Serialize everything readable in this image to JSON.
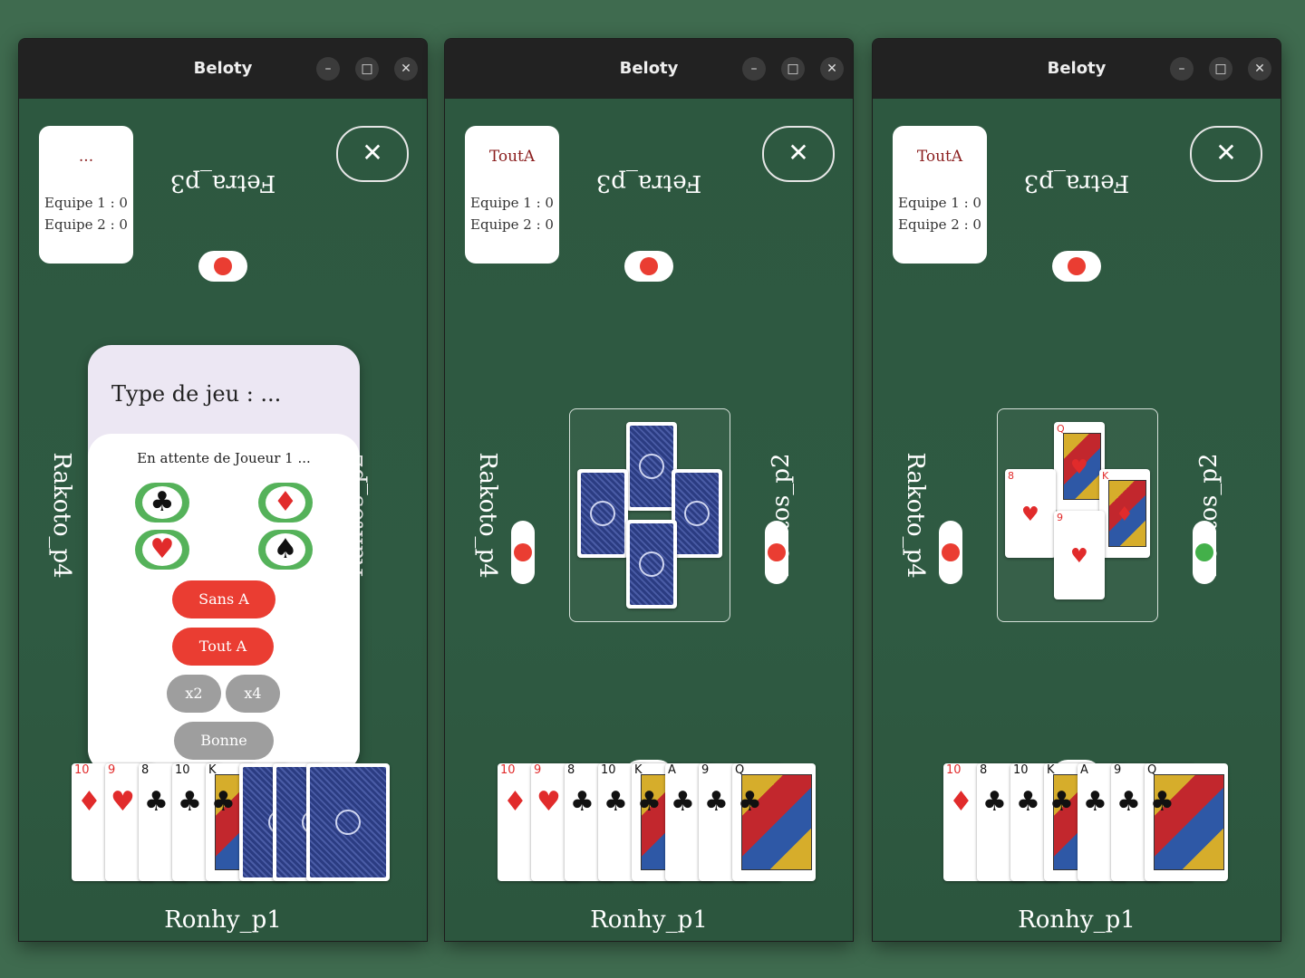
{
  "windows": [
    {
      "title": "Beloty",
      "score": {
        "mode": "...",
        "team1": "Equipe 1 : 0",
        "team2": "Equipe 2 : 0"
      },
      "close_label": "✕",
      "players": {
        "top": "Fetra_p3",
        "left": "Rakoto_p4",
        "right": "Raktos_p2",
        "bottom": "Ronhy_p1"
      },
      "dialog": {
        "title": "Type de jeu : ...",
        "waiting": "En attente de Joueur 1 ...",
        "suits": [
          "♣",
          "♦",
          "♥",
          "♠"
        ],
        "buttons": {
          "sans_a": "Sans A",
          "tout_a": "Tout A",
          "x2": "x2",
          "x4": "x4",
          "bonne": "Bonne"
        }
      },
      "hand": [
        {
          "rank": "10",
          "suit": "♦"
        },
        {
          "rank": "9",
          "suit": "♥"
        },
        {
          "rank": "8",
          "suit": "♣"
        },
        {
          "rank": "10",
          "suit": "♣"
        },
        {
          "rank": "K",
          "suit": "♣"
        },
        {
          "back": true
        },
        {
          "back": true
        },
        {
          "back": true
        }
      ]
    },
    {
      "title": "Beloty",
      "score": {
        "mode": "ToutA",
        "team1": "Equipe 1 : 0",
        "team2": "Equipe 2 : 0"
      },
      "close_label": "✕",
      "players": {
        "top": "Fetra_p3",
        "left": "Rakoto_p4",
        "right": "Raktos_p2",
        "bottom": "Ronhy_p1"
      },
      "hand": [
        {
          "rank": "10",
          "suit": "♦"
        },
        {
          "rank": "9",
          "suit": "♥"
        },
        {
          "rank": "8",
          "suit": "♣"
        },
        {
          "rank": "10",
          "suit": "♣"
        },
        {
          "rank": "K",
          "suit": "♣"
        },
        {
          "rank": "A",
          "suit": "♣"
        },
        {
          "rank": "9",
          "suit": "♣"
        },
        {
          "rank": "Q",
          "suit": "♣"
        }
      ]
    },
    {
      "title": "Beloty",
      "score": {
        "mode": "ToutA",
        "team1": "Equipe 1 : 0",
        "team2": "Equipe 2 : 0"
      },
      "close_label": "✕",
      "players": {
        "top": "Fetra_p3",
        "left": "Rakoto_p4",
        "right": "Raktos_p2",
        "bottom": "Ronhy_p1"
      },
      "table_cards": [
        {
          "rank": "Q",
          "suit": "♥"
        },
        {
          "rank": "8",
          "suit": "♥"
        },
        {
          "rank": "K",
          "suit": "♦"
        },
        {
          "rank": "9",
          "suit": "♥"
        }
      ],
      "hand": [
        {
          "rank": "10",
          "suit": "♦"
        },
        {
          "rank": "8",
          "suit": "♣"
        },
        {
          "rank": "10",
          "suit": "♣"
        },
        {
          "rank": "K",
          "suit": "♣"
        },
        {
          "rank": "A",
          "suit": "♣"
        },
        {
          "rank": "9",
          "suit": "♣"
        },
        {
          "rank": "Q",
          "suit": "♣"
        }
      ]
    }
  ],
  "colors": {
    "turn_active": "#43b04a",
    "turn_idle": "#ea3d32",
    "table": "#2f5a40"
  }
}
